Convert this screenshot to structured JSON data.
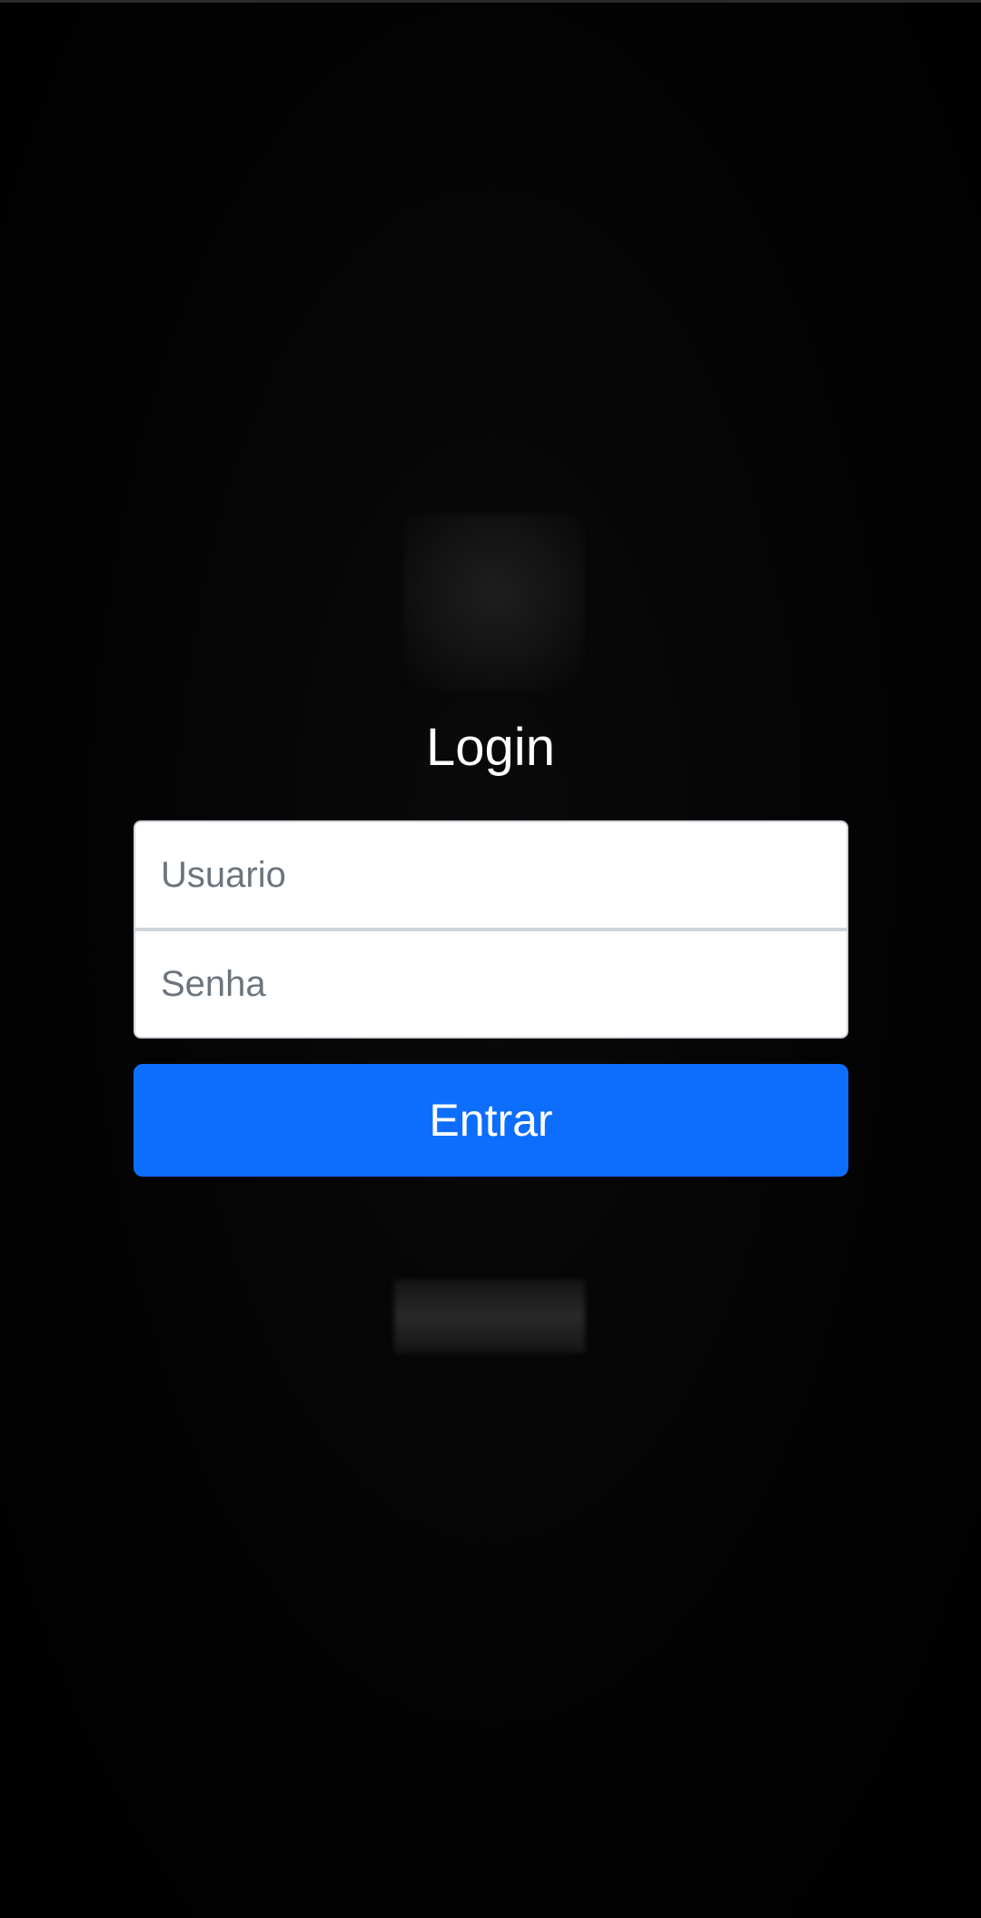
{
  "login": {
    "title": "Login",
    "username_placeholder": "Usuario",
    "password_placeholder": "Senha",
    "submit_label": "Entrar"
  },
  "theme": {
    "background": "#000000",
    "accent": "#0d6efd",
    "title_color": "#ffffff",
    "placeholder_color": "#6c757d"
  },
  "icons": {
    "logo": "app-logo-blurred",
    "footer": "footer-text-blurred"
  }
}
